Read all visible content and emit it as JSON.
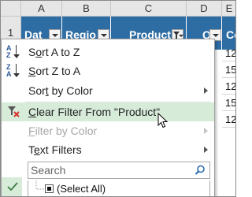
{
  "sheet": {
    "columns": [
      "A",
      "B",
      "C",
      "D",
      "E"
    ],
    "row_numbers": [
      "1"
    ],
    "table_headers": [
      {
        "label": "Dat",
        "filtered": false
      },
      {
        "label": "Regio",
        "filtered": false
      },
      {
        "label": "Product",
        "filtered": true
      },
      {
        "label": "Qt",
        "filtered": false
      },
      {
        "label": "Co",
        "filtered": false
      }
    ],
    "visible_cells_col_e": [
      "12",
      "15",
      "12",
      "15",
      "12"
    ]
  },
  "filter_menu": {
    "items": [
      {
        "prefix": "S",
        "accel": "o",
        "rest": "rt A to Z",
        "icon": "sort-a-z-icon",
        "enabled": true,
        "submenu": false,
        "highlighted": false
      },
      {
        "prefix": "",
        "accel": "S",
        "rest": "ort Z to A",
        "icon": "sort-z-a-icon",
        "enabled": true,
        "submenu": false,
        "highlighted": false
      },
      {
        "prefix": "Sor",
        "accel": "t",
        "rest": " by Color",
        "icon": "",
        "enabled": true,
        "submenu": true,
        "highlighted": false
      },
      {
        "prefix": "",
        "accel": "C",
        "rest": "lear Filter From \"Product\"",
        "icon": "clear-filter-icon",
        "enabled": true,
        "submenu": false,
        "highlighted": true
      },
      {
        "prefix": "",
        "accel": "F",
        "rest": "ilter by Color",
        "icon": "",
        "enabled": false,
        "submenu": true,
        "highlighted": false
      },
      {
        "prefix": "T",
        "accel": "e",
        "rest": "xt Filters",
        "icon": "",
        "enabled": true,
        "submenu": true,
        "highlighted": false
      }
    ],
    "search_placeholder": "Search",
    "tree_items": [
      {
        "label": "(Select All)",
        "state": "indeterminate"
      }
    ]
  },
  "colors": {
    "table_header": "#2e6da4",
    "highlight": "#d6ecd9",
    "accent_icon": "#2b5797"
  }
}
